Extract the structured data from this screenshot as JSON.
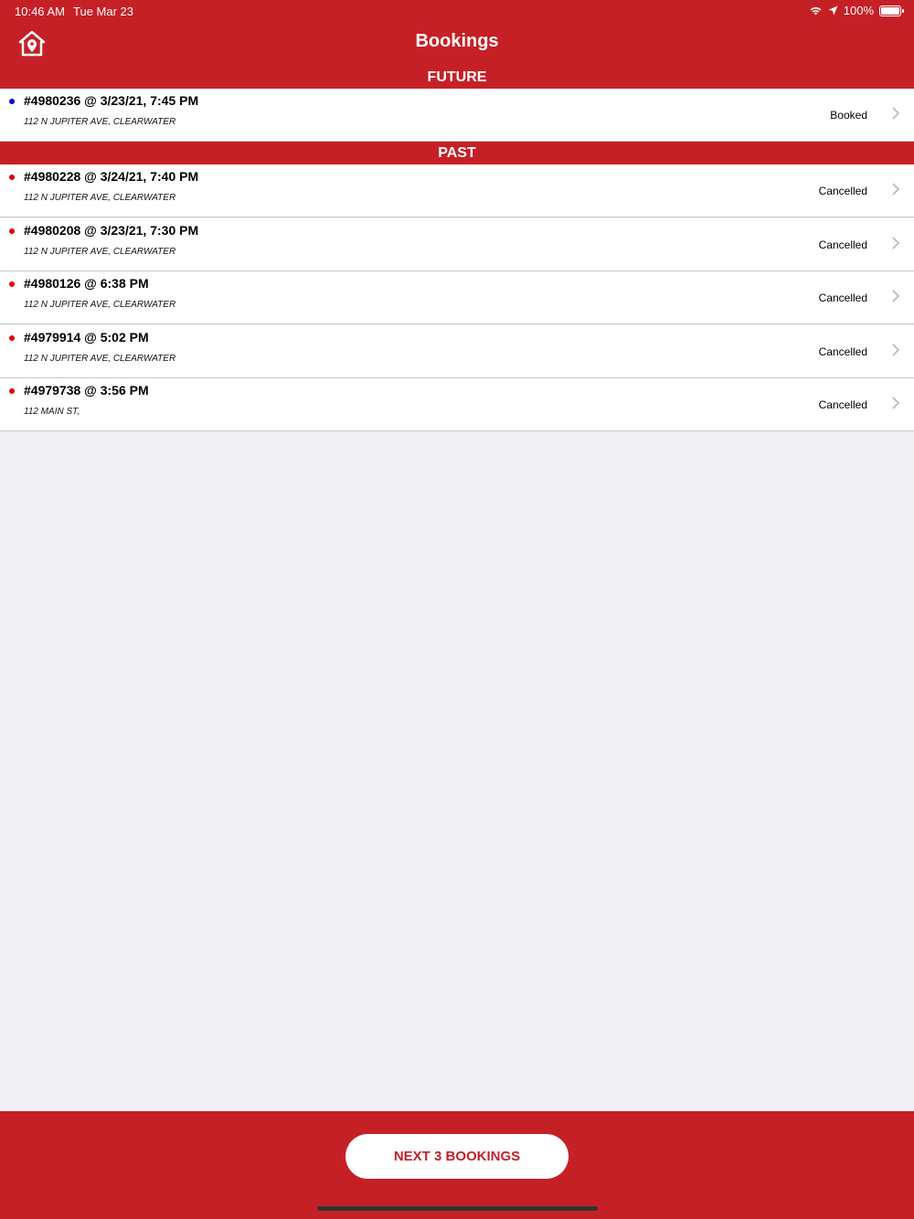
{
  "status_bar": {
    "time": "10:46 AM",
    "date": "Tue Mar 23",
    "battery": "100%"
  },
  "header": {
    "title": "Bookings",
    "home_icon": "home-location-icon"
  },
  "sections": {
    "future_label": "FUTURE",
    "past_label": "PAST"
  },
  "future_bookings": [
    {
      "title": "#4980236 @ 3/23/21, 7:45 PM",
      "address": "112 N JUPITER AVE, CLEARWATER",
      "status": "Booked",
      "dot_color": "#0000d6"
    }
  ],
  "past_bookings": [
    {
      "title": "#4980228 @ 3/24/21, 7:40 PM",
      "address": "112 N JUPITER AVE, CLEARWATER",
      "status": "Cancelled",
      "dot_color": "#e00000"
    },
    {
      "title": "#4980208 @ 3/23/21, 7:30 PM",
      "address": "112 N JUPITER AVE, CLEARWATER",
      "status": "Cancelled",
      "dot_color": "#e00000"
    },
    {
      "title": "#4980126 @ 6:38 PM",
      "address": "112 N JUPITER AVE, CLEARWATER",
      "status": "Cancelled",
      "dot_color": "#e00000"
    },
    {
      "title": "#4979914 @ 5:02 PM",
      "address": "112 N JUPITER AVE, CLEARWATER",
      "status": "Cancelled",
      "dot_color": "#e00000"
    },
    {
      "title": "#4979738 @ 3:56 PM",
      "address": "112 MAIN ST,",
      "status": "Cancelled",
      "dot_color": "#e00000"
    }
  ],
  "footer": {
    "next_button_label": "NEXT 3 BOOKINGS"
  },
  "colors": {
    "brand_red": "#c62027",
    "background": "#f0f0f5"
  }
}
